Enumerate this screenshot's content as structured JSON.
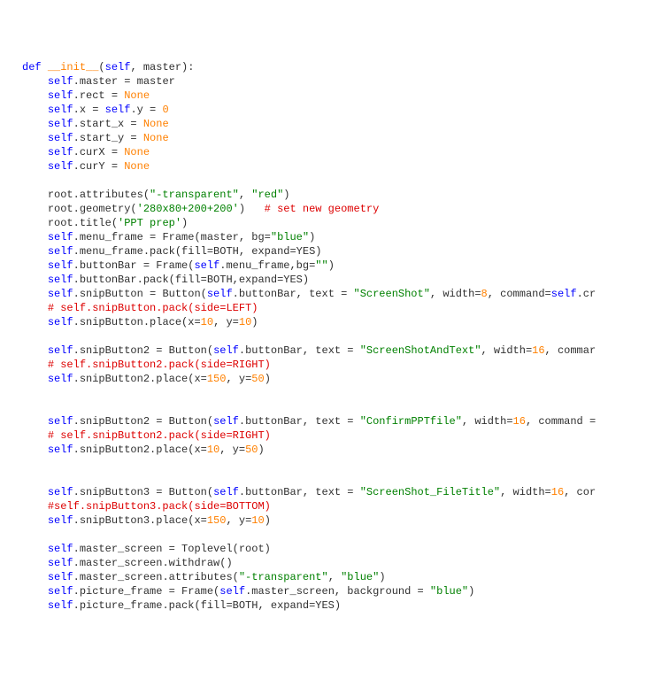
{
  "code": {
    "lines": [
      {
        "indent": 0,
        "segs": [
          {
            "cls": "kw",
            "t": "def"
          },
          {
            "cls": "plain",
            "t": " "
          },
          {
            "cls": "fn",
            "t": "__init__"
          },
          {
            "cls": "plain",
            "t": "("
          },
          {
            "cls": "self-kw",
            "t": "self"
          },
          {
            "cls": "plain",
            "t": ", master):"
          }
        ]
      },
      {
        "indent": 1,
        "segs": [
          {
            "cls": "self-kw",
            "t": "self"
          },
          {
            "cls": "plain",
            "t": ".master = master"
          }
        ]
      },
      {
        "indent": 1,
        "segs": [
          {
            "cls": "self-kw",
            "t": "self"
          },
          {
            "cls": "plain",
            "t": ".rect = "
          },
          {
            "cls": "fn",
            "t": "None"
          }
        ]
      },
      {
        "indent": 1,
        "segs": [
          {
            "cls": "self-kw",
            "t": "self"
          },
          {
            "cls": "plain",
            "t": ".x = "
          },
          {
            "cls": "self-kw",
            "t": "self"
          },
          {
            "cls": "plain",
            "t": ".y = "
          },
          {
            "cls": "num",
            "t": "0"
          }
        ]
      },
      {
        "indent": 1,
        "segs": [
          {
            "cls": "self-kw",
            "t": "self"
          },
          {
            "cls": "plain",
            "t": ".start_x = "
          },
          {
            "cls": "fn",
            "t": "None"
          }
        ]
      },
      {
        "indent": 1,
        "segs": [
          {
            "cls": "self-kw",
            "t": "self"
          },
          {
            "cls": "plain",
            "t": ".start_y = "
          },
          {
            "cls": "fn",
            "t": "None"
          }
        ]
      },
      {
        "indent": 1,
        "segs": [
          {
            "cls": "self-kw",
            "t": "self"
          },
          {
            "cls": "plain",
            "t": ".curX = "
          },
          {
            "cls": "fn",
            "t": "None"
          }
        ]
      },
      {
        "indent": 1,
        "segs": [
          {
            "cls": "self-kw",
            "t": "self"
          },
          {
            "cls": "plain",
            "t": ".curY = "
          },
          {
            "cls": "fn",
            "t": "None"
          }
        ]
      },
      {
        "indent": 1,
        "segs": []
      },
      {
        "indent": 1,
        "segs": [
          {
            "cls": "plain",
            "t": "root.attributes("
          },
          {
            "cls": "str",
            "t": "\"-transparent\""
          },
          {
            "cls": "plain",
            "t": ", "
          },
          {
            "cls": "str",
            "t": "\"red\""
          },
          {
            "cls": "plain",
            "t": ")"
          }
        ]
      },
      {
        "indent": 1,
        "segs": [
          {
            "cls": "plain",
            "t": "root.geometry("
          },
          {
            "cls": "str",
            "t": "'280x80+200+200'"
          },
          {
            "cls": "plain",
            "t": ")   "
          },
          {
            "cls": "comment",
            "t": "# set new geometry"
          }
        ]
      },
      {
        "indent": 1,
        "segs": [
          {
            "cls": "plain",
            "t": "root.title("
          },
          {
            "cls": "str",
            "t": "'PPT prep'"
          },
          {
            "cls": "plain",
            "t": ")"
          }
        ]
      },
      {
        "indent": 1,
        "segs": [
          {
            "cls": "self-kw",
            "t": "self"
          },
          {
            "cls": "plain",
            "t": ".menu_frame = Frame(master, bg="
          },
          {
            "cls": "str",
            "t": "\"blue\""
          },
          {
            "cls": "plain",
            "t": ")"
          }
        ]
      },
      {
        "indent": 1,
        "segs": [
          {
            "cls": "self-kw",
            "t": "self"
          },
          {
            "cls": "plain",
            "t": ".menu_frame.pack(fill=BOTH, expand=YES)"
          }
        ]
      },
      {
        "indent": 1,
        "segs": [
          {
            "cls": "self-kw",
            "t": "self"
          },
          {
            "cls": "plain",
            "t": ".buttonBar = Frame("
          },
          {
            "cls": "self-kw",
            "t": "self"
          },
          {
            "cls": "plain",
            "t": ".menu_frame,bg="
          },
          {
            "cls": "str",
            "t": "\"\""
          },
          {
            "cls": "plain",
            "t": ")"
          }
        ]
      },
      {
        "indent": 1,
        "segs": [
          {
            "cls": "self-kw",
            "t": "self"
          },
          {
            "cls": "plain",
            "t": ".buttonBar.pack(fill=BOTH,expand=YES)"
          }
        ]
      },
      {
        "indent": 1,
        "segs": [
          {
            "cls": "self-kw",
            "t": "self"
          },
          {
            "cls": "plain",
            "t": ".snipButton = Button("
          },
          {
            "cls": "self-kw",
            "t": "self"
          },
          {
            "cls": "plain",
            "t": ".buttonBar, text = "
          },
          {
            "cls": "str",
            "t": "\"ScreenShot\""
          },
          {
            "cls": "plain",
            "t": ", width="
          },
          {
            "cls": "num",
            "t": "8"
          },
          {
            "cls": "plain",
            "t": ", command="
          },
          {
            "cls": "self-kw",
            "t": "self"
          },
          {
            "cls": "plain",
            "t": ".cr"
          }
        ]
      },
      {
        "indent": 1,
        "segs": [
          {
            "cls": "comment",
            "t": "# self.snipButton.pack(side=LEFT)"
          }
        ]
      },
      {
        "indent": 1,
        "segs": [
          {
            "cls": "self-kw",
            "t": "self"
          },
          {
            "cls": "plain",
            "t": ".snipButton.place(x="
          },
          {
            "cls": "num",
            "t": "10"
          },
          {
            "cls": "plain",
            "t": ", y="
          },
          {
            "cls": "num",
            "t": "10"
          },
          {
            "cls": "plain",
            "t": ")"
          }
        ]
      },
      {
        "indent": 1,
        "segs": []
      },
      {
        "indent": 1,
        "segs": [
          {
            "cls": "self-kw",
            "t": "self"
          },
          {
            "cls": "plain",
            "t": ".snipButton2 = Button("
          },
          {
            "cls": "self-kw",
            "t": "self"
          },
          {
            "cls": "plain",
            "t": ".buttonBar, text = "
          },
          {
            "cls": "str",
            "t": "\"ScreenShotAndText\""
          },
          {
            "cls": "plain",
            "t": ", width="
          },
          {
            "cls": "num",
            "t": "16"
          },
          {
            "cls": "plain",
            "t": ", commar"
          }
        ]
      },
      {
        "indent": 1,
        "segs": [
          {
            "cls": "comment",
            "t": "# self.snipButton2.pack(side=RIGHT)"
          }
        ]
      },
      {
        "indent": 1,
        "segs": [
          {
            "cls": "self-kw",
            "t": "self"
          },
          {
            "cls": "plain",
            "t": ".snipButton2.place(x="
          },
          {
            "cls": "num",
            "t": "150"
          },
          {
            "cls": "plain",
            "t": ", y="
          },
          {
            "cls": "num",
            "t": "50"
          },
          {
            "cls": "plain",
            "t": ")"
          }
        ]
      },
      {
        "indent": 1,
        "segs": []
      },
      {
        "indent": 1,
        "segs": []
      },
      {
        "indent": 1,
        "segs": [
          {
            "cls": "self-kw",
            "t": "self"
          },
          {
            "cls": "plain",
            "t": ".snipButton2 = Button("
          },
          {
            "cls": "self-kw",
            "t": "self"
          },
          {
            "cls": "plain",
            "t": ".buttonBar, text = "
          },
          {
            "cls": "str",
            "t": "\"ConfirmPPTfile\""
          },
          {
            "cls": "plain",
            "t": ", width="
          },
          {
            "cls": "num",
            "t": "16"
          },
          {
            "cls": "plain",
            "t": ", command ="
          }
        ]
      },
      {
        "indent": 1,
        "segs": [
          {
            "cls": "comment",
            "t": "# self.snipButton2.pack(side=RIGHT)"
          }
        ]
      },
      {
        "indent": 1,
        "segs": [
          {
            "cls": "self-kw",
            "t": "self"
          },
          {
            "cls": "plain",
            "t": ".snipButton2.place(x="
          },
          {
            "cls": "num",
            "t": "10"
          },
          {
            "cls": "plain",
            "t": ", y="
          },
          {
            "cls": "num",
            "t": "50"
          },
          {
            "cls": "plain",
            "t": ")"
          }
        ]
      },
      {
        "indent": 1,
        "segs": []
      },
      {
        "indent": 1,
        "segs": []
      },
      {
        "indent": 1,
        "segs": [
          {
            "cls": "self-kw",
            "t": "self"
          },
          {
            "cls": "plain",
            "t": ".snipButton3 = Button("
          },
          {
            "cls": "self-kw",
            "t": "self"
          },
          {
            "cls": "plain",
            "t": ".buttonBar, text = "
          },
          {
            "cls": "str",
            "t": "\"ScreenShot_FileTitle\""
          },
          {
            "cls": "plain",
            "t": ", width="
          },
          {
            "cls": "num",
            "t": "16"
          },
          {
            "cls": "plain",
            "t": ", cor"
          }
        ]
      },
      {
        "indent": 1,
        "segs": [
          {
            "cls": "comment",
            "t": "#self.snipButton3.pack(side=BOTTOM)"
          }
        ]
      },
      {
        "indent": 1,
        "segs": [
          {
            "cls": "self-kw",
            "t": "self"
          },
          {
            "cls": "plain",
            "t": ".snipButton3.place(x="
          },
          {
            "cls": "num",
            "t": "150"
          },
          {
            "cls": "plain",
            "t": ", y="
          },
          {
            "cls": "num",
            "t": "10"
          },
          {
            "cls": "plain",
            "t": ")"
          }
        ]
      },
      {
        "indent": 1,
        "segs": []
      },
      {
        "indent": 1,
        "segs": [
          {
            "cls": "self-kw",
            "t": "self"
          },
          {
            "cls": "plain",
            "t": ".master_screen = Toplevel(root)"
          }
        ]
      },
      {
        "indent": 1,
        "segs": [
          {
            "cls": "self-kw",
            "t": "self"
          },
          {
            "cls": "plain",
            "t": ".master_screen.withdraw()"
          }
        ]
      },
      {
        "indent": 1,
        "segs": [
          {
            "cls": "self-kw",
            "t": "self"
          },
          {
            "cls": "plain",
            "t": ".master_screen.attributes("
          },
          {
            "cls": "str",
            "t": "\"-transparent\""
          },
          {
            "cls": "plain",
            "t": ", "
          },
          {
            "cls": "str",
            "t": "\"blue\""
          },
          {
            "cls": "plain",
            "t": ")"
          }
        ]
      },
      {
        "indent": 1,
        "segs": [
          {
            "cls": "self-kw",
            "t": "self"
          },
          {
            "cls": "plain",
            "t": ".picture_frame = Frame("
          },
          {
            "cls": "self-kw",
            "t": "self"
          },
          {
            "cls": "plain",
            "t": ".master_screen, background = "
          },
          {
            "cls": "str",
            "t": "\"blue\""
          },
          {
            "cls": "plain",
            "t": ")"
          }
        ]
      },
      {
        "indent": 1,
        "segs": [
          {
            "cls": "self-kw",
            "t": "self"
          },
          {
            "cls": "plain",
            "t": ".picture_frame.pack(fill=BOTH, expand=YES)"
          }
        ]
      }
    ],
    "indentUnit": "    "
  }
}
